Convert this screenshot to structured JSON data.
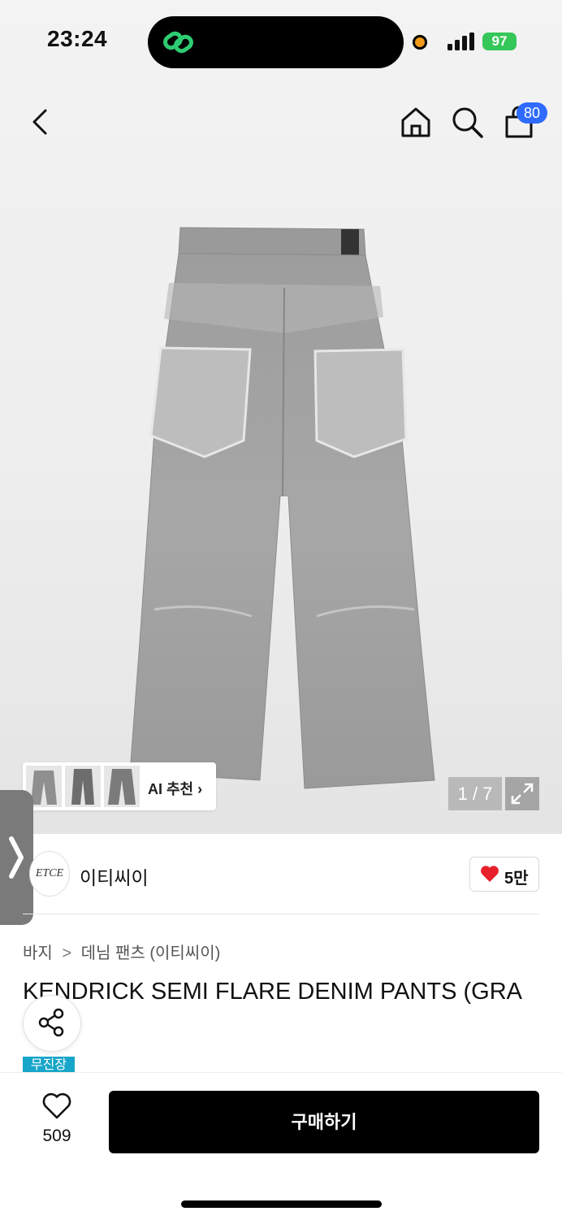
{
  "status_bar": {
    "time": "23:24",
    "battery": "97"
  },
  "product_image": {
    "counter": "1 / 7"
  },
  "header": {
    "cart_count": "80"
  },
  "ai_recommend": {
    "label": "AI 추천"
  },
  "brand": {
    "logo_text": "ETCE",
    "name": "이티씨이",
    "likes": "5만"
  },
  "breadcrumb": {
    "category": "바지",
    "separator": ">",
    "subcategory": "데님 팬츠 (이티씨이)"
  },
  "product": {
    "title": "KENDRICK SEMI FLARE DENIM PANTS (GRA",
    "shipping_badge": "무진장"
  },
  "bottom_bar": {
    "wish_count": "509",
    "buy_label": "구매하기"
  },
  "colors": {
    "accent_blue": "#2f6bff",
    "heart_red": "#e8202a",
    "badge_cyan": "#17a6c9",
    "battery_green": "#35c759"
  }
}
